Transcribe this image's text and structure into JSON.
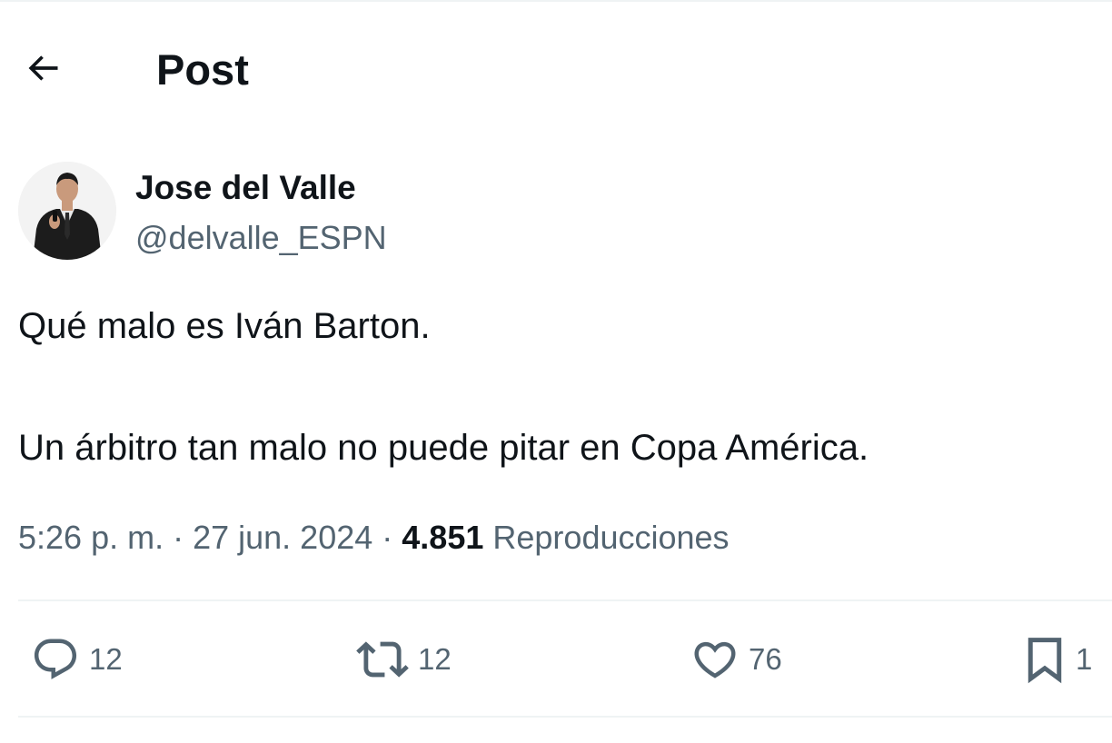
{
  "header": {
    "title": "Post",
    "back_icon": "arrow-left-icon"
  },
  "author": {
    "name": "Jose del Valle",
    "handle": "@delvalle_ESPN",
    "avatar_icon": "profile-photo-avatar"
  },
  "post": {
    "paragraphs": [
      "Qué malo es Iván Barton.",
      "Un árbitro tan malo no puede pitar en Copa América."
    ]
  },
  "meta": {
    "time": "5:26 p. m.",
    "separator": " · ",
    "date": "27 jun. 2024",
    "views_count": "4.851",
    "views_label": "Reproducciones"
  },
  "actions": {
    "reply": {
      "icon": "reply-bubble-icon",
      "count": "12"
    },
    "repost": {
      "icon": "repost-arrows-icon",
      "count": "12"
    },
    "like": {
      "icon": "heart-icon",
      "count": "76"
    },
    "bookmark": {
      "icon": "bookmark-icon",
      "count": "1"
    }
  },
  "colors": {
    "text_primary": "#0f1419",
    "text_secondary": "#536471",
    "divider": "#eff3f4",
    "background": "#ffffff"
  }
}
